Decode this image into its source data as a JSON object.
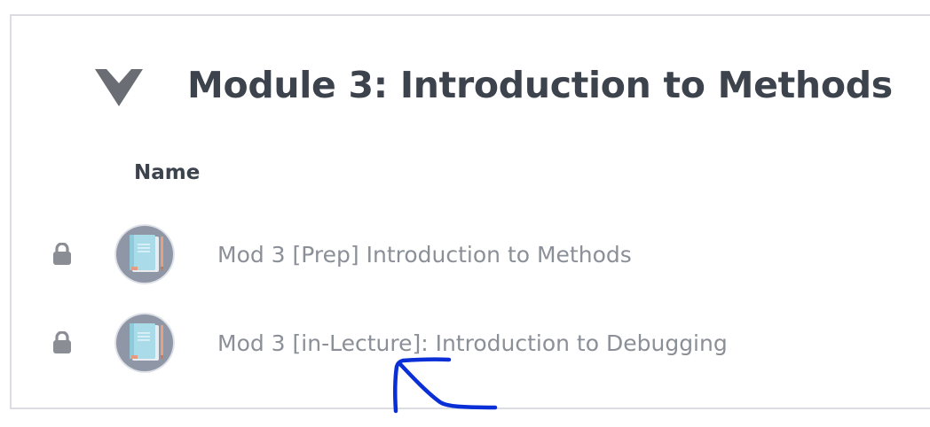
{
  "module": {
    "title": "Module 3: Introduction to Methods",
    "collapse_icon": "chevron-down-icon"
  },
  "table": {
    "column_header": "Name",
    "items": [
      {
        "label": "Mod 3 [Prep] Introduction to Methods",
        "lock_icon": "lock-icon",
        "thumbnail_icon": "book-icon"
      },
      {
        "label": "Mod 3 [in-Lecture]: Introduction to Debugging",
        "lock_icon": "lock-icon",
        "thumbnail_icon": "book-icon"
      }
    ]
  },
  "annotation": {
    "type": "hand-drawn-arrow",
    "color": "#0a2fd6"
  },
  "colors": {
    "heading": "#3d434c",
    "item_text": "#8b8f97",
    "border": "#dcdde3",
    "icon_gray": "#8a8d93",
    "avatar_bg": "#8f97a6"
  }
}
